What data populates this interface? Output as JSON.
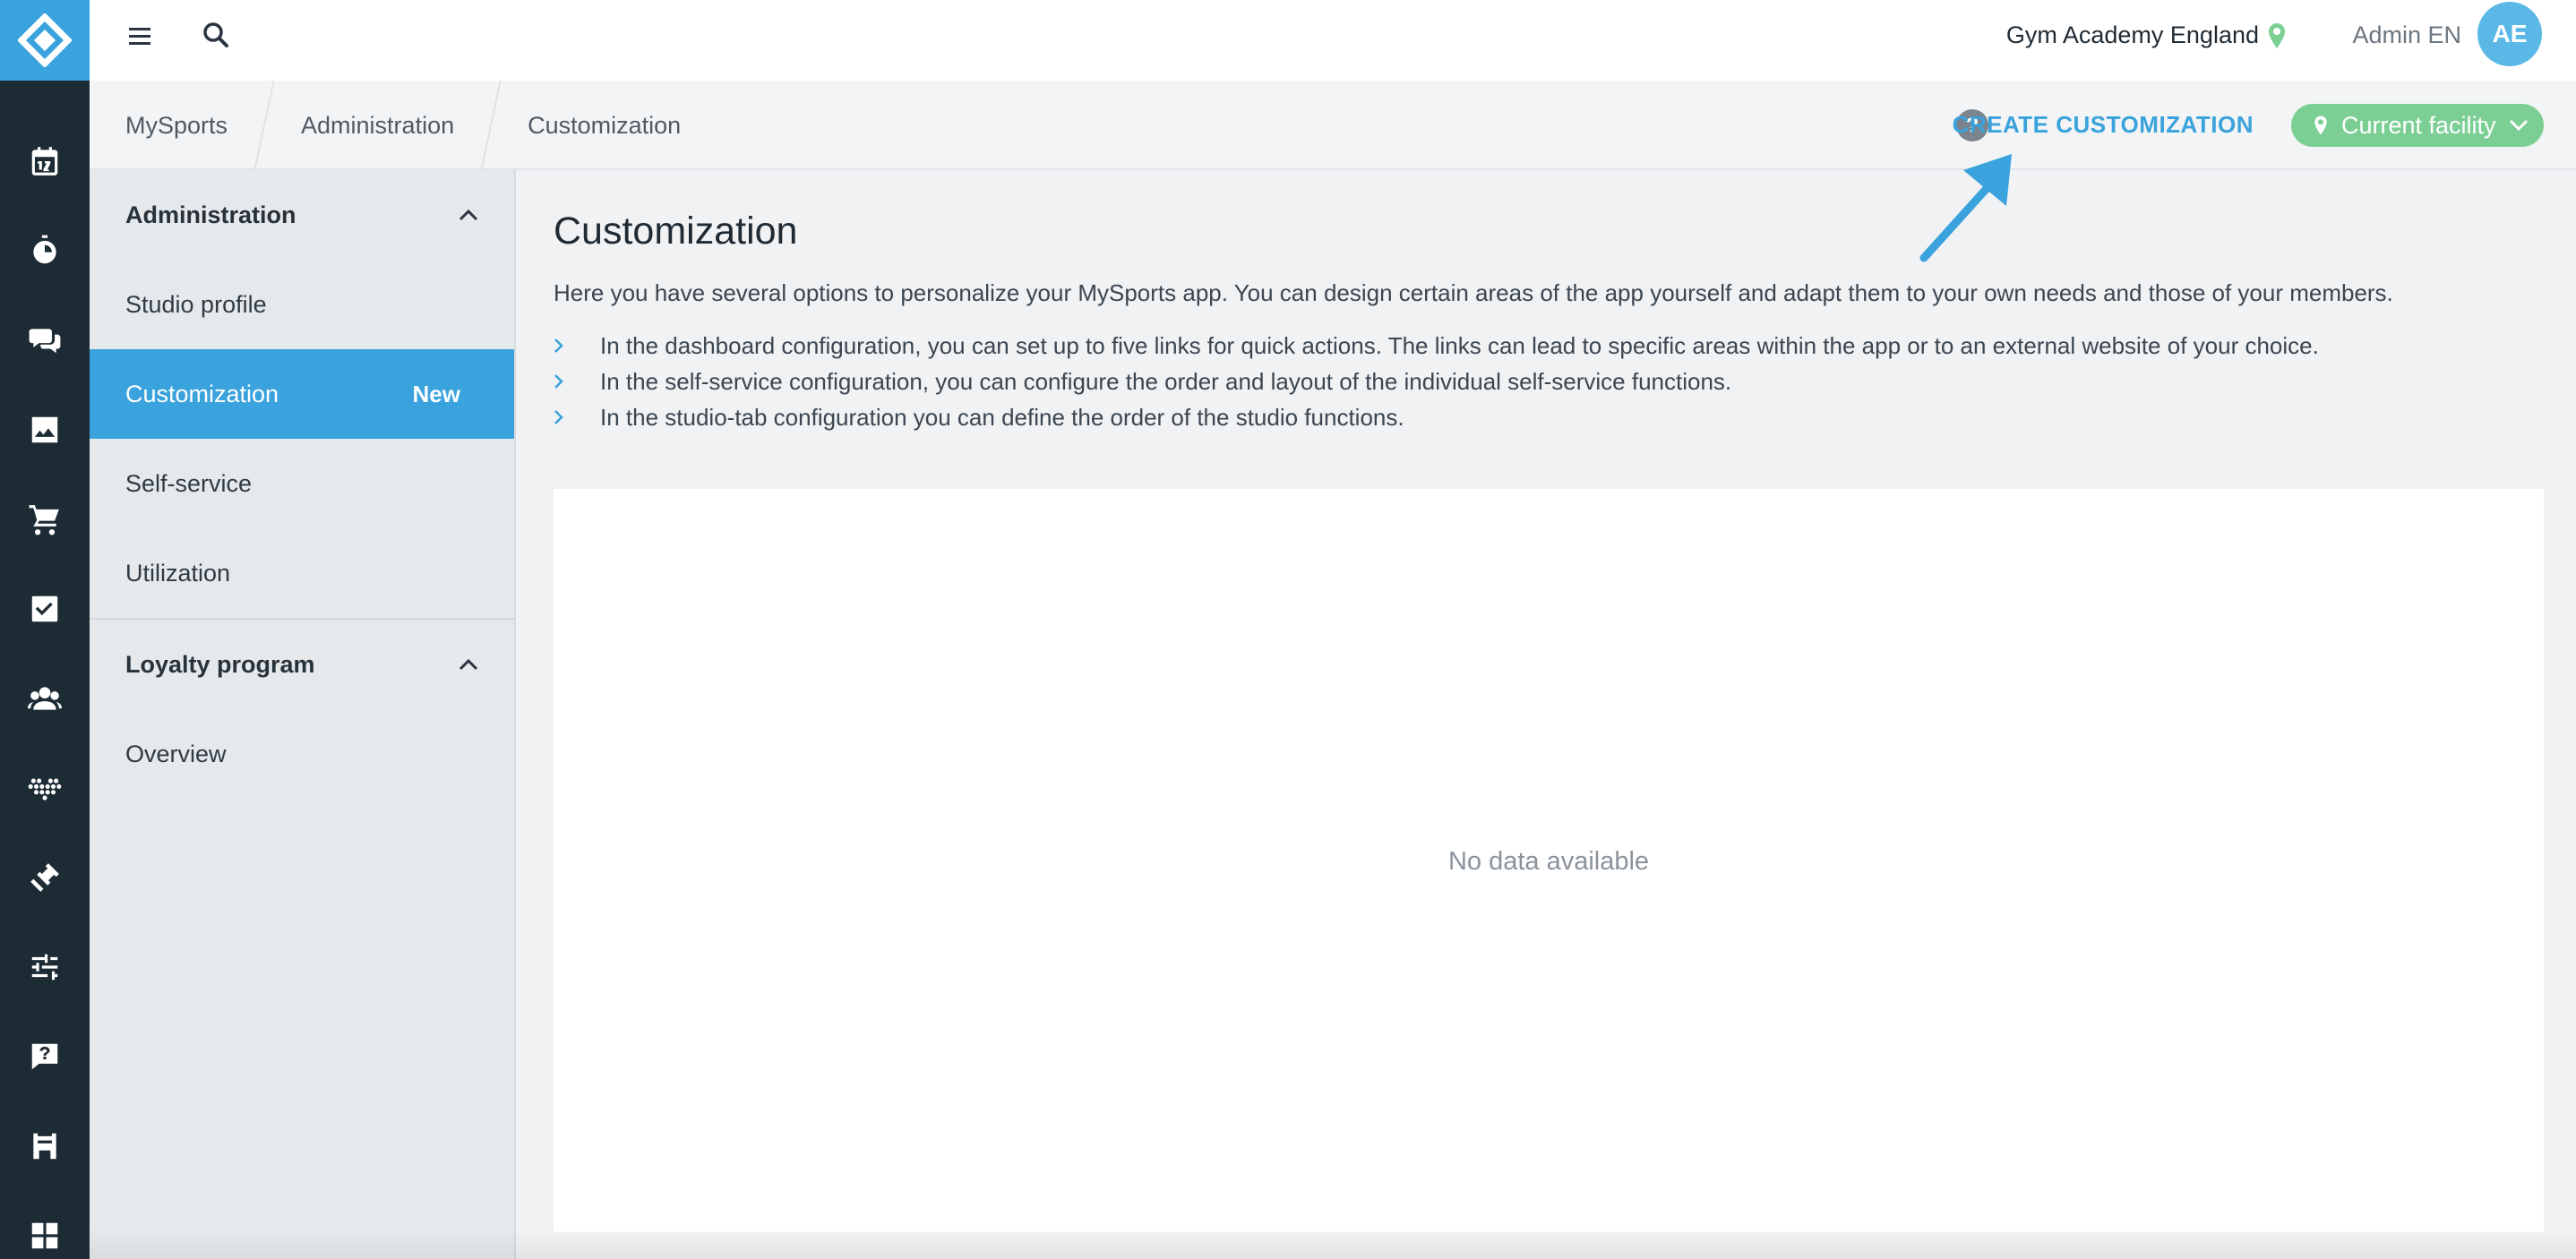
{
  "topbar": {
    "facility_name": "Gym Academy England",
    "user_name": "Admin EN",
    "avatar_initials": "AE"
  },
  "breadcrumb": [
    "MySports",
    "Administration",
    "Customization"
  ],
  "actions": {
    "create_label": "CREATE CUSTOMIZATION",
    "facility_button_label": "Current facility"
  },
  "subnav": {
    "groups": [
      {
        "title": "Administration",
        "items": [
          {
            "label": "Studio profile"
          },
          {
            "label": "Customization",
            "badge": "New"
          },
          {
            "label": "Self-service"
          },
          {
            "label": "Utilization"
          }
        ]
      },
      {
        "title": "Loyalty program",
        "items": [
          {
            "label": "Overview"
          }
        ]
      }
    ]
  },
  "main": {
    "title": "Customization",
    "intro": "Here you have several options to personalize your MySports app. You can design certain areas of the app yourself and adapt them to your own needs and those of your members.",
    "bullets": [
      "In the dashboard configuration, you can set up to five links for quick actions. The links can lead to specific areas within the app or to an external website of your choice.",
      "In the self-service configuration, you can configure the order and layout of the individual self-service functions.",
      "In the studio-tab configuration you can define the order of the studio functions."
    ],
    "empty_text": "No data available"
  },
  "rail_icons": [
    "calendar-icon",
    "stopwatch-icon",
    "chat-icon",
    "image-icon",
    "cart-icon",
    "checkbox-icon",
    "members-icon",
    "heart-dots-icon",
    "dumbbell-icon",
    "sliders-icon",
    "question-chat-icon",
    "store-icon",
    "dashboard-icon"
  ],
  "colors": {
    "accent": "#3aa2dc",
    "rail": "#1d2b34",
    "facility_button": "#7ccf94",
    "avatar": "#5bb8e6"
  }
}
